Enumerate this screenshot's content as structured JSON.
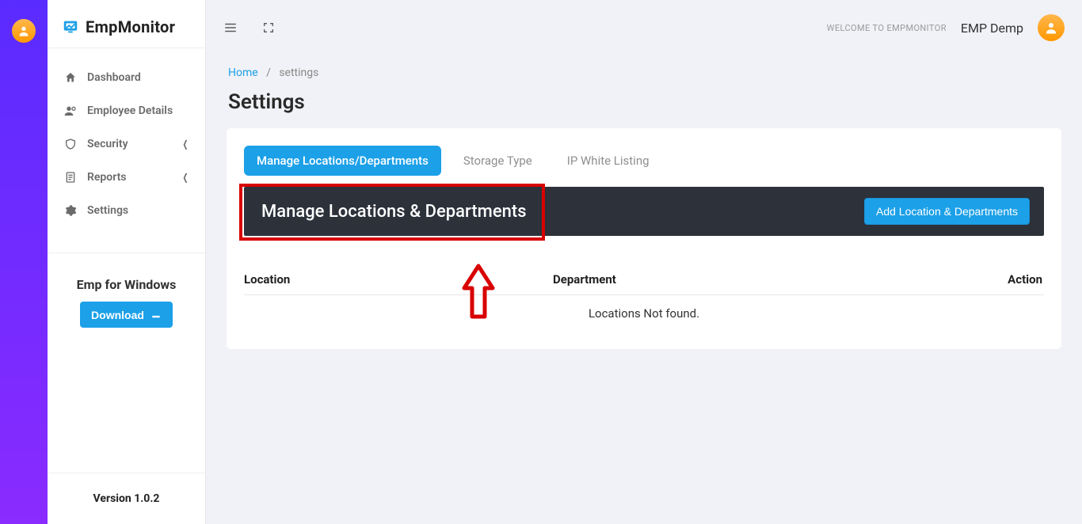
{
  "brand": {
    "name": "EmpMonitor"
  },
  "sidebar": {
    "dashboard": "Dashboard",
    "employee_details": "Employee Details",
    "security": "Security",
    "reports": "Reports",
    "settings": "Settings"
  },
  "sidebar_promo": {
    "title": "Emp for Windows",
    "button": "Download"
  },
  "version": "Version 1.0.2",
  "topbar": {
    "welcome": "WELCOME TO EMPMONITOR",
    "username": "EMP Demp"
  },
  "breadcrumbs": {
    "home": "Home",
    "current": "settings"
  },
  "page_title": "Settings",
  "tabs": {
    "manage": "Manage Locations/Departments",
    "storage": "Storage Type",
    "ip": "IP White Listing"
  },
  "panel": {
    "title": "Manage Locations & Departments",
    "add_button": "Add Location & Departments"
  },
  "table": {
    "cols": {
      "location": "Location",
      "department": "Department",
      "action": "Action"
    },
    "empty": "Locations Not found."
  }
}
